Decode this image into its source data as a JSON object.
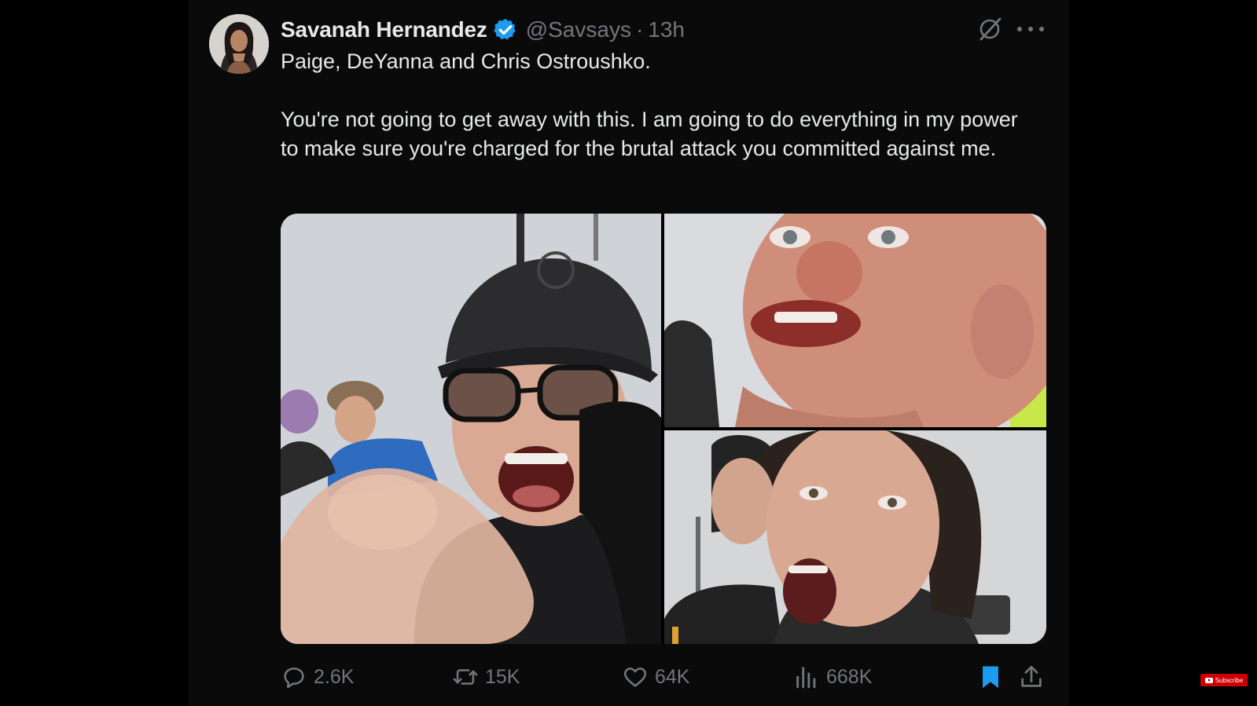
{
  "tweet": {
    "author": {
      "display_name": "Savanah Hernandez",
      "handle": "@Savsays",
      "verified": true,
      "avatar_icon": "profile-photo"
    },
    "separator": "·",
    "time": "13h",
    "text": {
      "line1": "Paige, DeYanna and Chris Ostroushko.",
      "paragraph2": "You're not going to get away with this. I am going to do everything in my power to make sure you're charged for the brutal attack you committed against me."
    },
    "media": {
      "count": 3,
      "items": [
        {
          "icon": "photo-woman-in-cap-shouting"
        },
        {
          "icon": "photo-man-shouting"
        },
        {
          "icon": "photo-woman-shouting"
        }
      ]
    },
    "actions": {
      "replies": "2.6K",
      "reposts": "15K",
      "likes": "64K",
      "views": "668K",
      "bookmarked": true
    },
    "icons": {
      "grok": "grok-icon",
      "more": "more-icon",
      "reply": "reply-icon",
      "repost": "repost-icon",
      "like": "heart-icon",
      "views": "views-icon",
      "bookmark": "bookmark-icon",
      "share": "share-icon"
    }
  },
  "overlay": {
    "subscribe_label": "Subscribe"
  },
  "colors": {
    "background": "#000000",
    "card": "#0a0a0a",
    "primary_text": "#e7e9ea",
    "secondary_text": "#71767b",
    "verified_blue": "#1d9bf0",
    "bookmark_blue": "#1d9bf0",
    "youtube_red": "#cc0000"
  }
}
